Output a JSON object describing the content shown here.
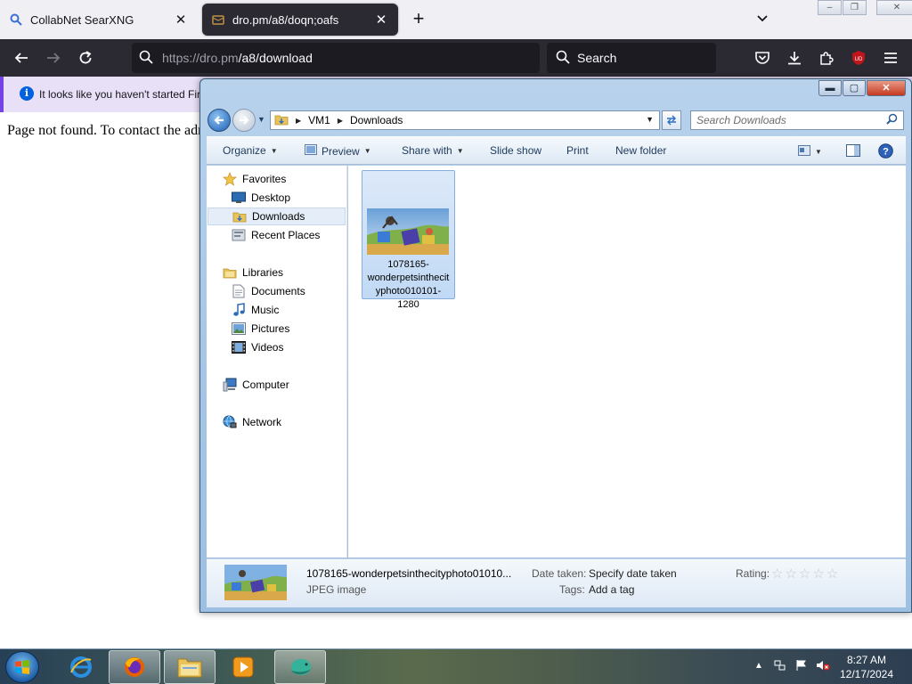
{
  "browser": {
    "tabs": [
      {
        "title": "CollabNet SearXNG",
        "active": false
      },
      {
        "title": "dro.pm/a8/doqn;oafs",
        "active": true
      }
    ],
    "url_host": "https://dro.pm",
    "url_path": "/a8/download",
    "search_placeholder": "Search",
    "notification": "It looks like you haven't started Firefox in a while. Do you want to clean it up for a fresh, like-new experience? And by the way, welcome back!",
    "page_text": "Page not found. To contact the administrator, click the link below.",
    "extension_badge": "UD"
  },
  "explorer": {
    "breadcrumb": [
      "VM1",
      "Downloads"
    ],
    "search_placeholder": "Search Downloads",
    "toolbar": {
      "organize": "Organize",
      "preview": "Preview",
      "share_with": "Share with",
      "slide_show": "Slide show",
      "print": "Print",
      "new_folder": "New folder"
    },
    "nav": {
      "favorites": "Favorites",
      "desktop": "Desktop",
      "downloads": "Downloads",
      "recent_places": "Recent Places",
      "libraries": "Libraries",
      "documents": "Documents",
      "music": "Music",
      "pictures": "Pictures",
      "videos": "Videos",
      "computer": "Computer",
      "network": "Network"
    },
    "file": {
      "name": "1078165-wonderpetsinthecityphoto010101-1280"
    },
    "details": {
      "name_truncated": "1078165-wonderpetsinthecityphoto01010...",
      "type": "JPEG image",
      "date_taken_label": "Date taken:",
      "date_taken_value": "Specify date taken",
      "tags_label": "Tags:",
      "tags_value": "Add a tag",
      "rating_label": "Rating:",
      "rating_value": 0
    }
  },
  "taskbar": {
    "time": "8:27 AM",
    "date": "12/17/2024"
  },
  "colors": {
    "firefox_dark": "#2b2a33",
    "notification_bg": "#e8e0f7",
    "explorer_frame": "#a7c6e6",
    "selection": "#c1d9f5"
  }
}
